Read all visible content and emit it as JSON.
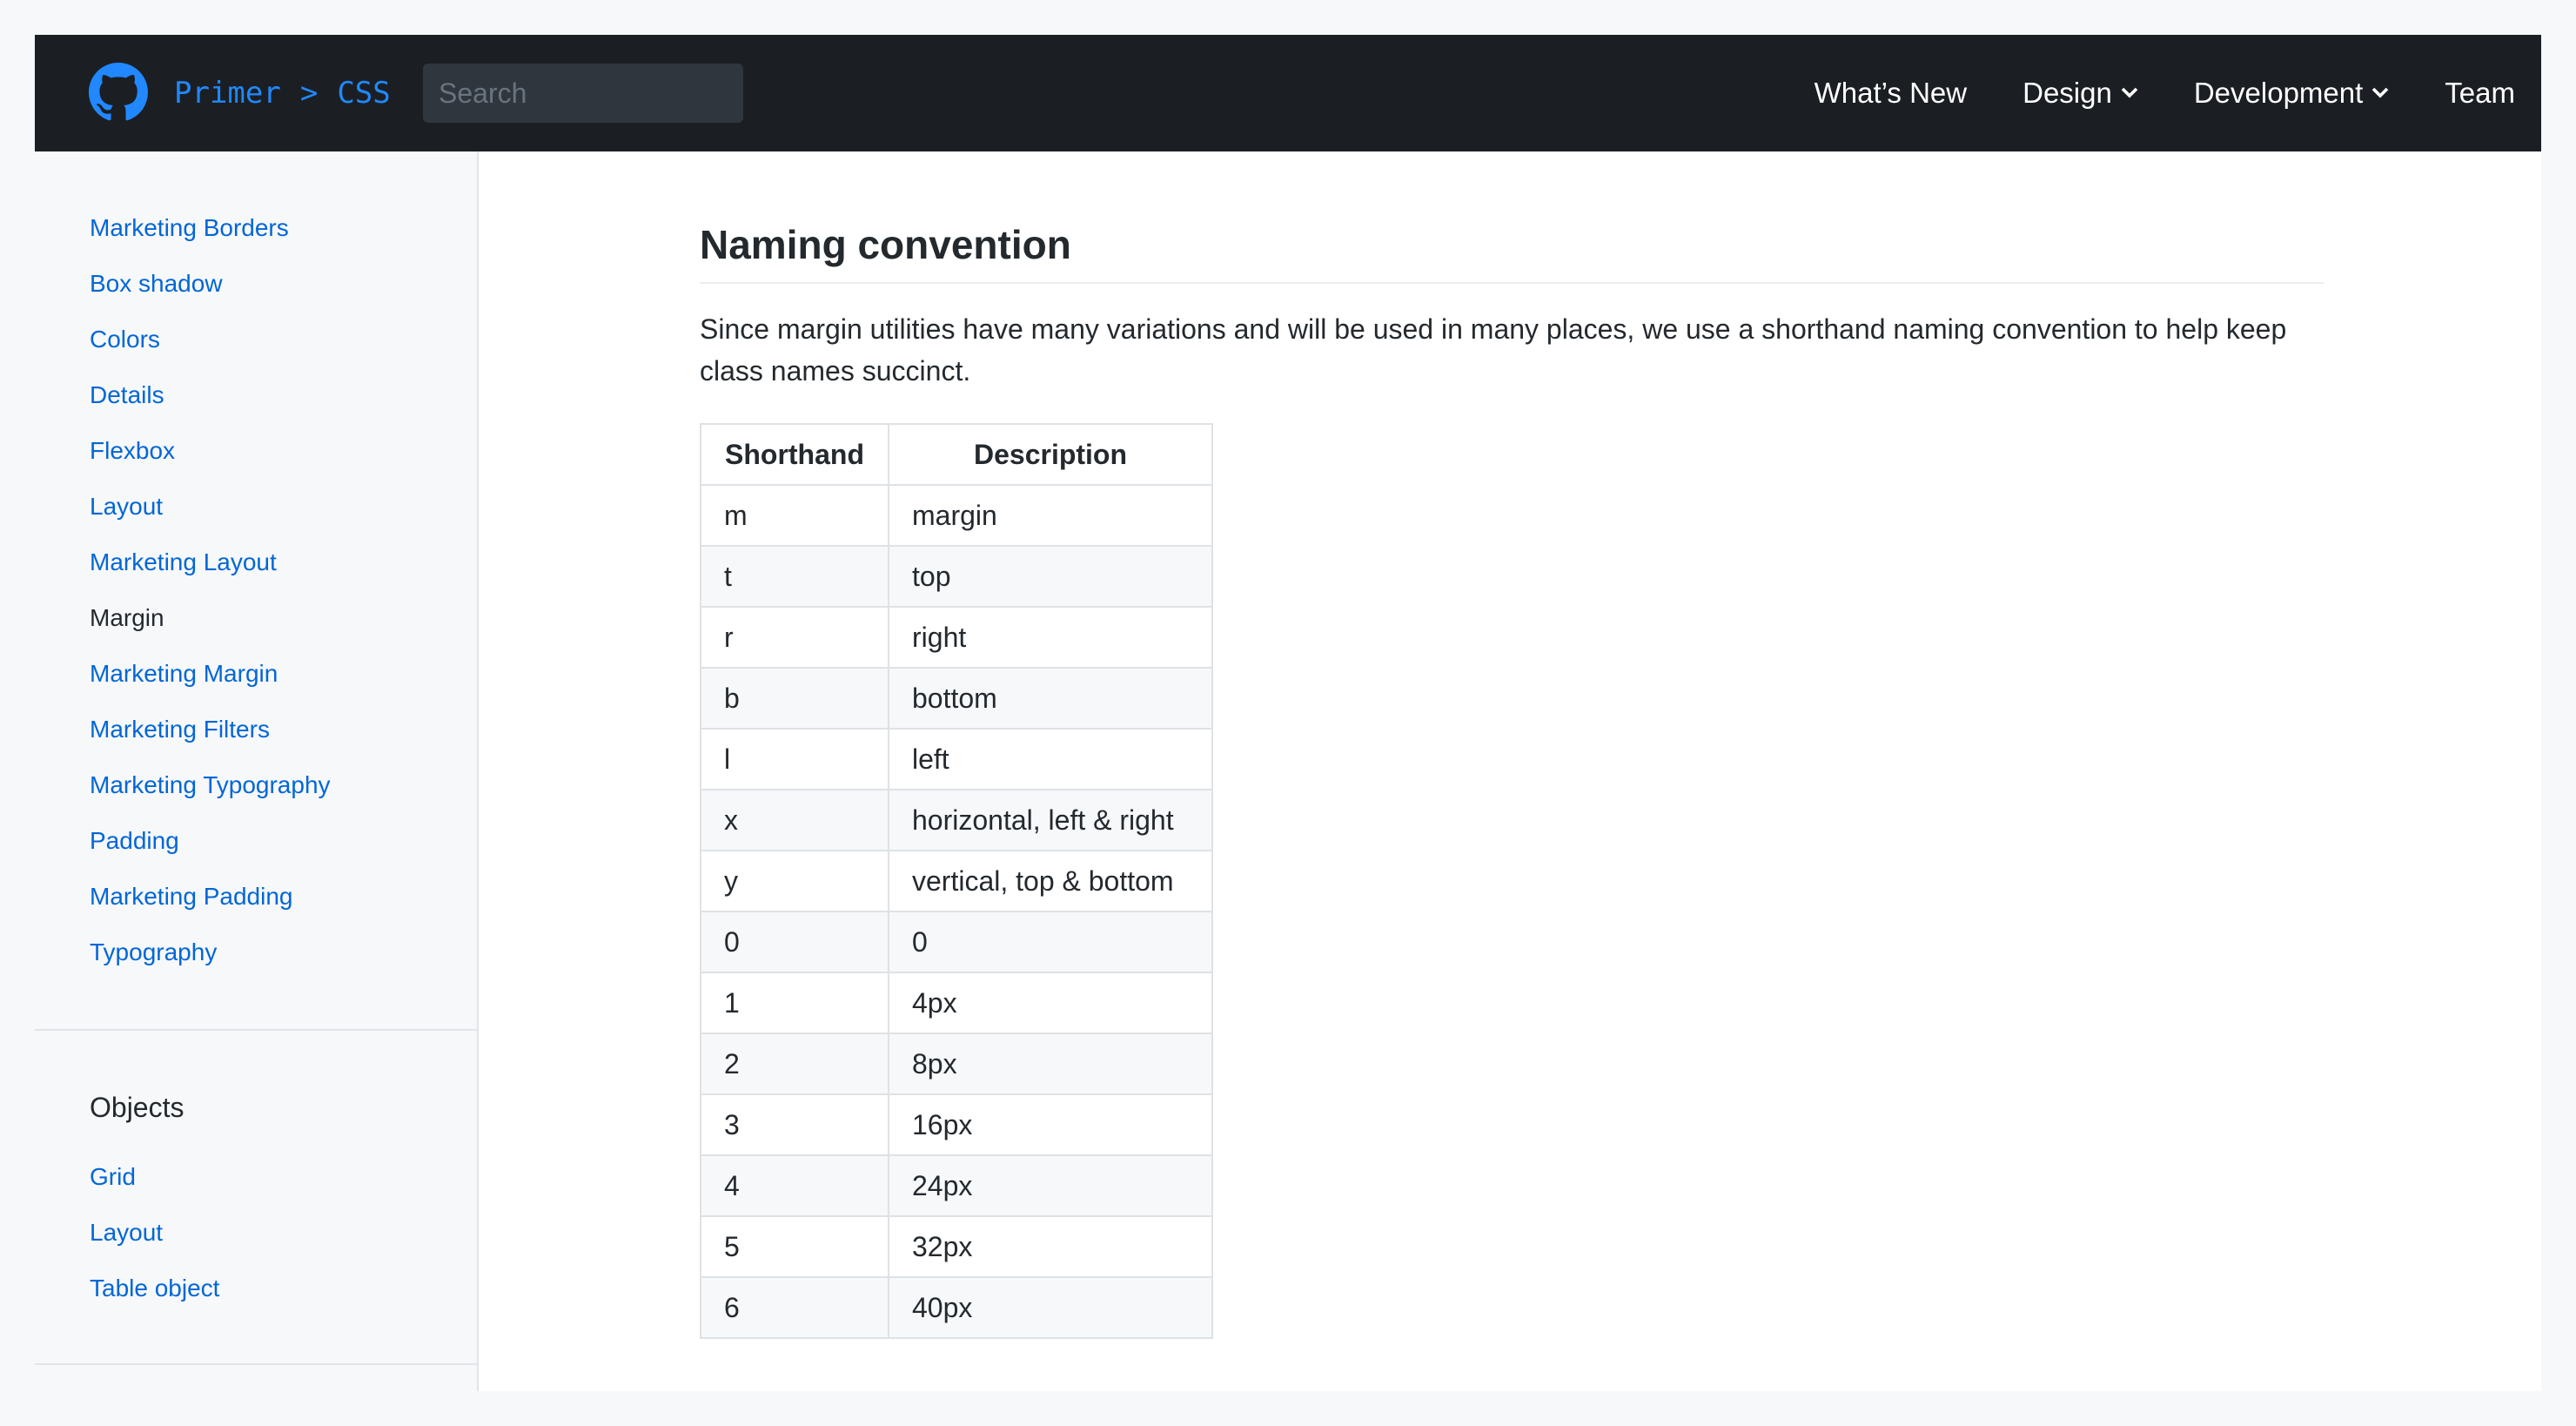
{
  "header": {
    "brand_primary": "Primer",
    "brand_separator": ">",
    "brand_secondary": "CSS",
    "search_placeholder": "Search",
    "nav": [
      {
        "label": "What’s New",
        "has_dropdown": false
      },
      {
        "label": "Design",
        "has_dropdown": true
      },
      {
        "label": "Development",
        "has_dropdown": true
      },
      {
        "label": "Team",
        "has_dropdown": false
      }
    ]
  },
  "sidebar": {
    "links": [
      "Marketing Borders",
      "Box shadow",
      "Colors",
      "Details",
      "Flexbox",
      "Layout",
      "Marketing Layout",
      "Margin",
      "Marketing Margin",
      "Marketing Filters",
      "Marketing Typography",
      "Padding",
      "Marketing Padding",
      "Typography"
    ],
    "active_link": "Margin",
    "objects_heading": "Objects",
    "object_links": [
      "Grid",
      "Layout",
      "Table object"
    ]
  },
  "main": {
    "heading": "Naming convention",
    "paragraph": "Since margin utilities have many variations and will be used in many places, we use a shorthand naming convention to help keep class names succinct.",
    "table": {
      "headers": [
        "Shorthand",
        "Description"
      ],
      "rows": [
        [
          "m",
          "margin"
        ],
        [
          "t",
          "top"
        ],
        [
          "r",
          "right"
        ],
        [
          "b",
          "bottom"
        ],
        [
          "l",
          "left"
        ],
        [
          "x",
          "horizontal, left & right"
        ],
        [
          "y",
          "vertical, top & bottom"
        ],
        [
          "0",
          "0"
        ],
        [
          "1",
          "4px"
        ],
        [
          "2",
          "8px"
        ],
        [
          "3",
          "16px"
        ],
        [
          "4",
          "24px"
        ],
        [
          "5",
          "32px"
        ],
        [
          "6",
          "40px"
        ]
      ]
    }
  },
  "colors": {
    "link": "#0366d6",
    "brand_accent": "#2188ff",
    "header_bg": "#1b1f23"
  }
}
